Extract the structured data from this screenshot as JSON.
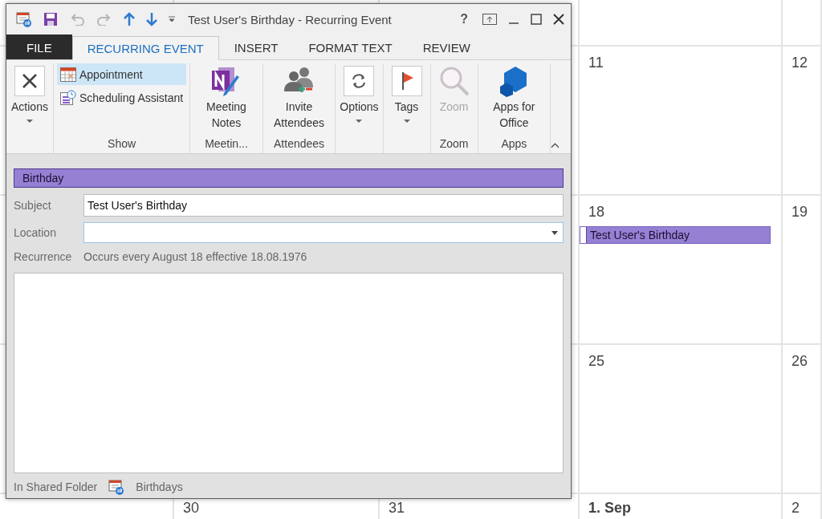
{
  "calendar": {
    "weeks": [
      {
        "cells": [
          null,
          null,
          null,
          null,
          null
        ]
      },
      {
        "cells": [
          null,
          null,
          null,
          {
            "date": "11",
            "first_of_month": false
          },
          {
            "date": "12",
            "first_of_month": false
          }
        ]
      },
      {
        "cells": [
          null,
          null,
          null,
          {
            "date": "18",
            "first_of_month": false,
            "events": [
              {
                "title": "Test User's Birthday"
              }
            ]
          },
          {
            "date": "19",
            "first_of_month": false
          }
        ]
      },
      {
        "cells": [
          null,
          null,
          null,
          {
            "date": "25",
            "first_of_month": false
          },
          {
            "date": "26",
            "first_of_month": false
          }
        ]
      },
      {
        "cells": [
          null,
          {
            "date": "30",
            "first_of_month": false
          },
          {
            "date": "31",
            "first_of_month": false
          },
          {
            "date": "1. Sep",
            "first_of_month": true
          },
          {
            "date": "2",
            "first_of_month": false
          }
        ]
      }
    ]
  },
  "window": {
    "title": "Test User's Birthday - Recurring Event",
    "help": "?"
  },
  "tabs": [
    {
      "label": "FILE",
      "kind": "file",
      "selected": false
    },
    {
      "label": "RECURRING EVENT",
      "kind": "tab",
      "selected": true
    },
    {
      "label": "INSERT",
      "kind": "tab",
      "selected": false
    },
    {
      "label": "FORMAT TEXT",
      "kind": "tab",
      "selected": false
    },
    {
      "label": "REVIEW",
      "kind": "tab",
      "selected": false
    }
  ],
  "ribbon": {
    "groups": [
      {
        "buttons": [
          {
            "kind": "large",
            "label": "Actions",
            "dropdown": true,
            "disabled": false
          }
        ]
      },
      {
        "label": "Show",
        "buttons": [
          {
            "kind": "small",
            "label": "Appointment",
            "selected": true
          },
          {
            "kind": "small",
            "label": "Scheduling Assistant",
            "selected": false
          }
        ]
      },
      {
        "label": "Meetin...",
        "buttons": [
          {
            "kind": "large",
            "label": "Meeting Notes",
            "dropdown": false,
            "disabled": false
          }
        ]
      },
      {
        "label": "Attendees",
        "buttons": [
          {
            "kind": "large",
            "label": "Invite Attendees",
            "dropdown": false,
            "disabled": false
          }
        ]
      },
      {
        "buttons": [
          {
            "kind": "large",
            "label": "Options",
            "dropdown": true,
            "disabled": false
          }
        ]
      },
      {
        "buttons": [
          {
            "kind": "large",
            "label": "Tags",
            "dropdown": true,
            "disabled": false
          }
        ]
      },
      {
        "label": "Zoom",
        "buttons": [
          {
            "kind": "large",
            "label": "Zoom",
            "dropdown": false,
            "disabled": true
          }
        ]
      },
      {
        "label": "Apps",
        "buttons": [
          {
            "kind": "large",
            "label": "Apps for Office",
            "dropdown": false,
            "disabled": false
          }
        ]
      }
    ]
  },
  "form": {
    "category": "Birthday",
    "fields": [
      {
        "label": "Subject",
        "kind": "text",
        "value": "Test User's Birthday"
      },
      {
        "label": "Location",
        "kind": "dropdown"
      }
    ],
    "recurrence": {
      "label": "Recurrence",
      "text": "Occurs every August 18 effective 18.08.1976"
    },
    "footer": {
      "label": "In Shared Folder",
      "folder": "Birthdays"
    }
  }
}
